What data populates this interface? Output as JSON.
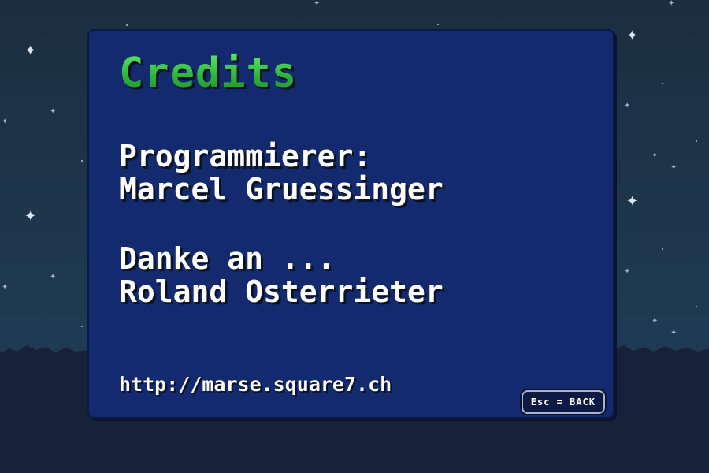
{
  "screen": {
    "title": "Credits",
    "credits": [
      "Programmierer:",
      "Marcel Gruessinger",
      "Danke an ...",
      "Roland Osterrieter"
    ],
    "url": "http://marse.square7.ch",
    "back_button": "Esc = BACK"
  },
  "colors": {
    "sky": "#1d3347",
    "panel": "#142a6e",
    "title_green": "#3fd34f",
    "text": "#ffffff",
    "ground": "#172236"
  },
  "icons": {
    "stars": "star-icon"
  }
}
